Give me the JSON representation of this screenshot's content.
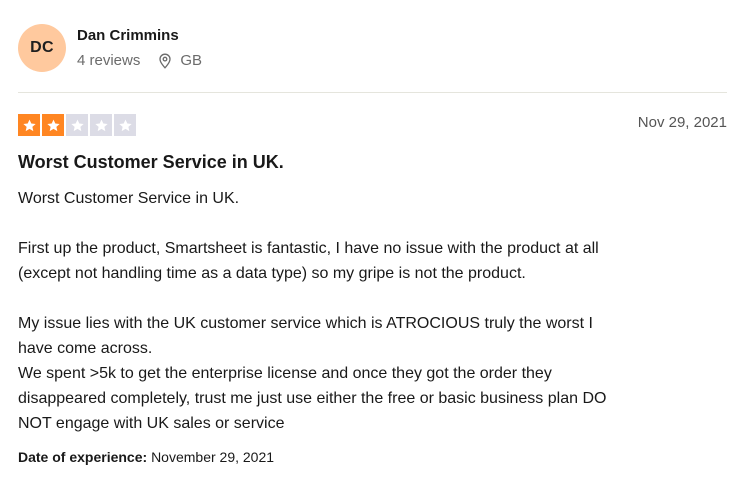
{
  "reviewer": {
    "initials": "DC",
    "name": "Dan Crimmins",
    "review_count": "4 reviews",
    "country": "GB",
    "avatar_color": "#ffc99e"
  },
  "rating": {
    "stars_filled": 2,
    "stars_total": 5,
    "filled_color": "#ff8622",
    "empty_color": "#dcdce6",
    "icon": "star-icon"
  },
  "review": {
    "date": "Nov 29, 2021",
    "title": "Worst Customer Service in UK.",
    "paragraphs": [
      [
        "Worst Customer Service in UK."
      ],
      [
        "First up the product, Smartsheet is fantastic, I have no issue with the product at all",
        "(except not handling time as a data type) so my gripe is not the product."
      ],
      [
        "My issue lies with the UK customer service which is ATROCIOUS truly the worst I",
        "have come across.",
        "We spent >5k to get the enterprise license and once they got the order they",
        "disappeared completely, trust me just use either the free or basic business plan DO",
        "NOT engage with UK sales or service"
      ]
    ],
    "experience_label": "Date of experience:",
    "experience_date": "November 29, 2021"
  }
}
